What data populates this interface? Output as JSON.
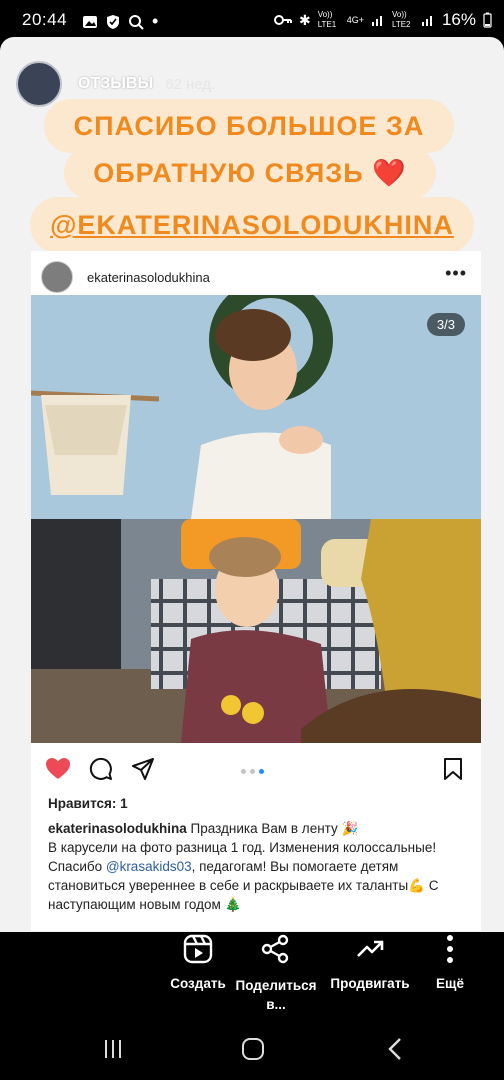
{
  "status_bar": {
    "time": "20:44",
    "network_1": "Vo)) LTE1",
    "network_mid": "4G+",
    "network_2": "Vo)) LTE2",
    "battery": "16%"
  },
  "story": {
    "account": "ОТЗЫВЫ",
    "age": "62 нед."
  },
  "banners": {
    "line1": "СПАСИБО БОЛЬШОЕ ЗА",
    "line2": "ОБРАТНУЮ СВЯЗЬ ❤️",
    "mention": "@EKATERINASOLODUKHINA"
  },
  "post": {
    "username": "ekaterinasolodukhina",
    "more": "•••",
    "counter": "3/3",
    "likes": "Нравится: 1",
    "caption_user": "ekaterinasolodukhina",
    "caption_text_1": " Праздника Вам в ленту 🎉",
    "caption_text_2": "В карусели на фото разница 1 год. Изменения колоссальные! Спасибо ",
    "caption_mention": "@krasakids03",
    "caption_text_3": ", педагогам! Вы помогаете детям становиться увереннее в себе и раскрываете их таланты💪 С наступающим новым годом 🎄"
  },
  "bottom_actions": {
    "create": "Создать",
    "share": "Поделиться в...",
    "promote": "Продвигать",
    "more": "Ещё"
  },
  "colors": {
    "banner_bg": "#fbe8cf",
    "banner_text": "#f08a1f",
    "like_red": "#ed4956",
    "pager_active": "#1e90ff"
  }
}
